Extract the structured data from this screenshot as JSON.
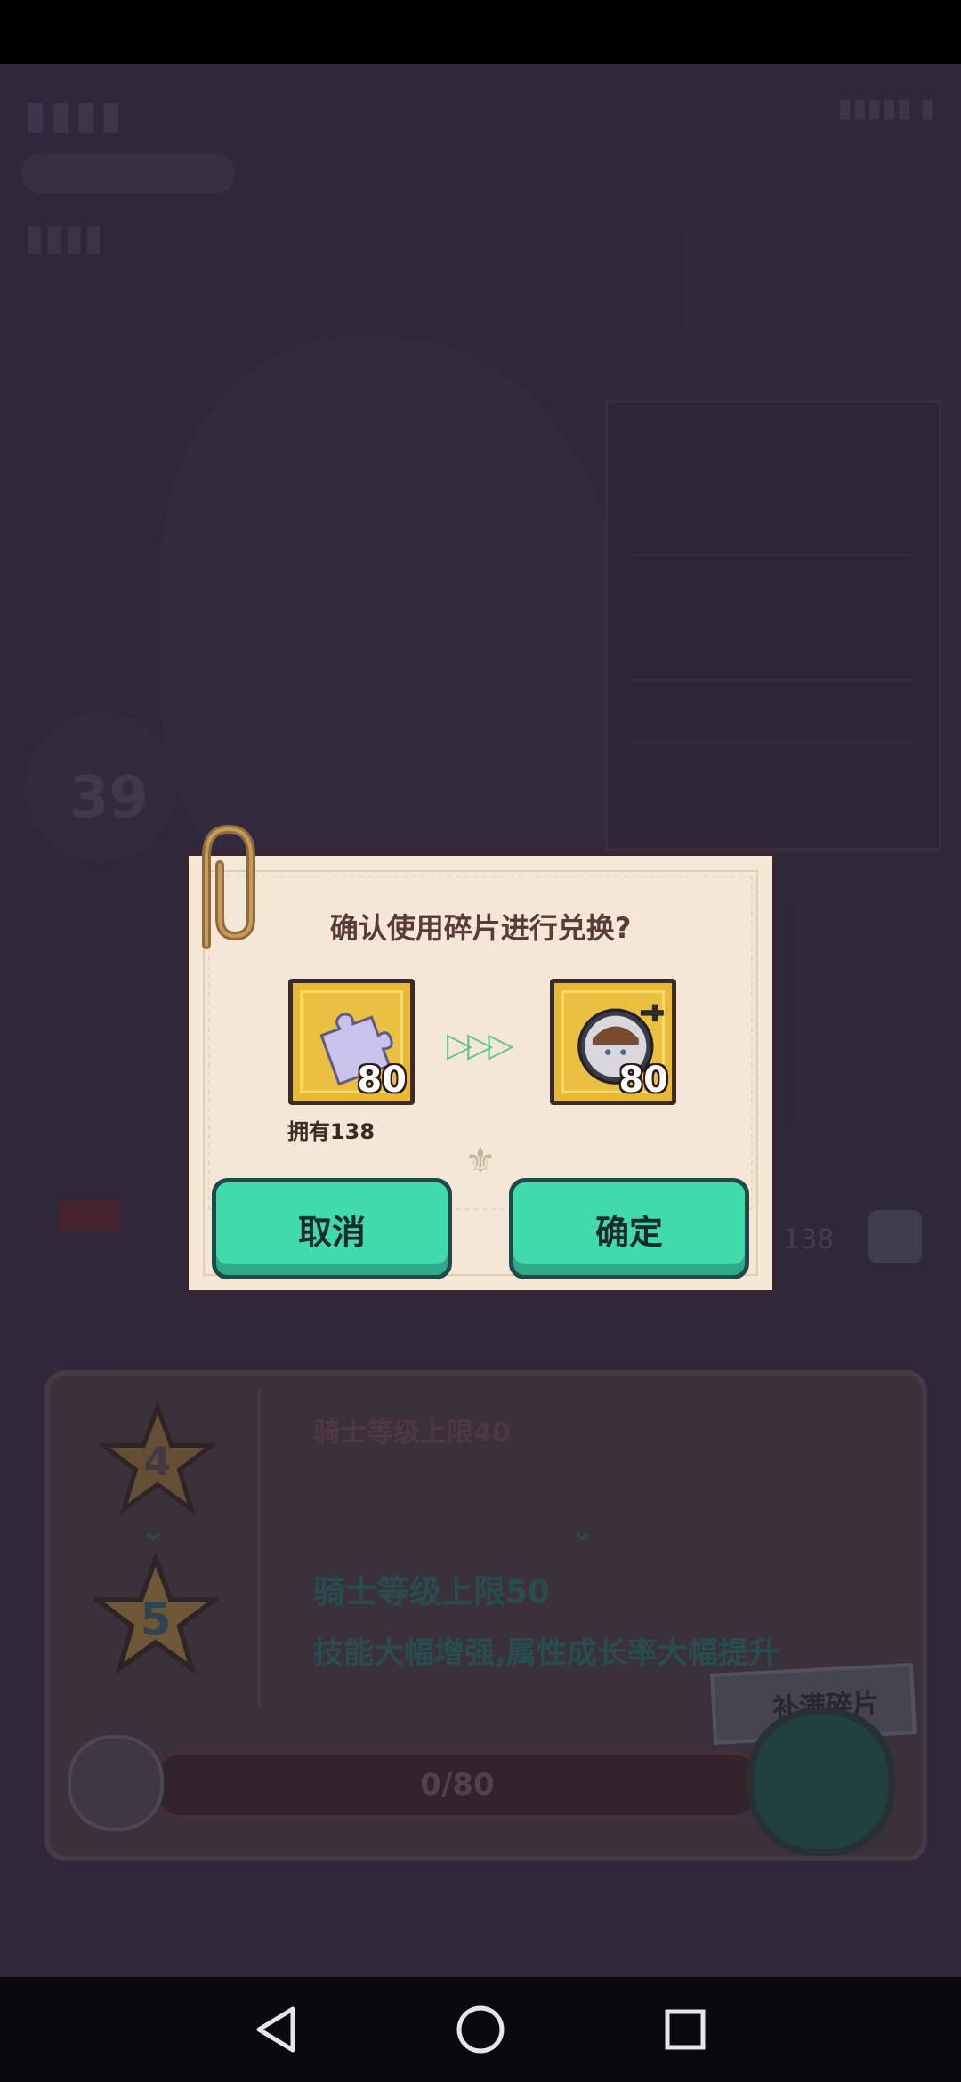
{
  "dialog": {
    "title": "确认使用碎片进行兑换?",
    "source_item": {
      "icon": "puzzle-piece-icon",
      "count": "80"
    },
    "owned_label": "拥有138",
    "target_item": {
      "icon": "hero-portrait-icon",
      "count": "80"
    },
    "cancel_label": "取消",
    "confirm_label": "确定"
  },
  "background": {
    "star_current": "4",
    "star_next": "5",
    "current_limit": "骑士等级上限40",
    "next_limit": "骑士等级上限50",
    "next_desc": "技能大幅增强,属性成长率大幅提升",
    "fill_button": "补满碎片",
    "progress": "0/80",
    "owned_count": "138",
    "level_value": "39"
  },
  "colors": {
    "accent_button": "#40dbaa",
    "dialog_bg": "#f4e7d6",
    "item_frame": "#e9b932"
  }
}
